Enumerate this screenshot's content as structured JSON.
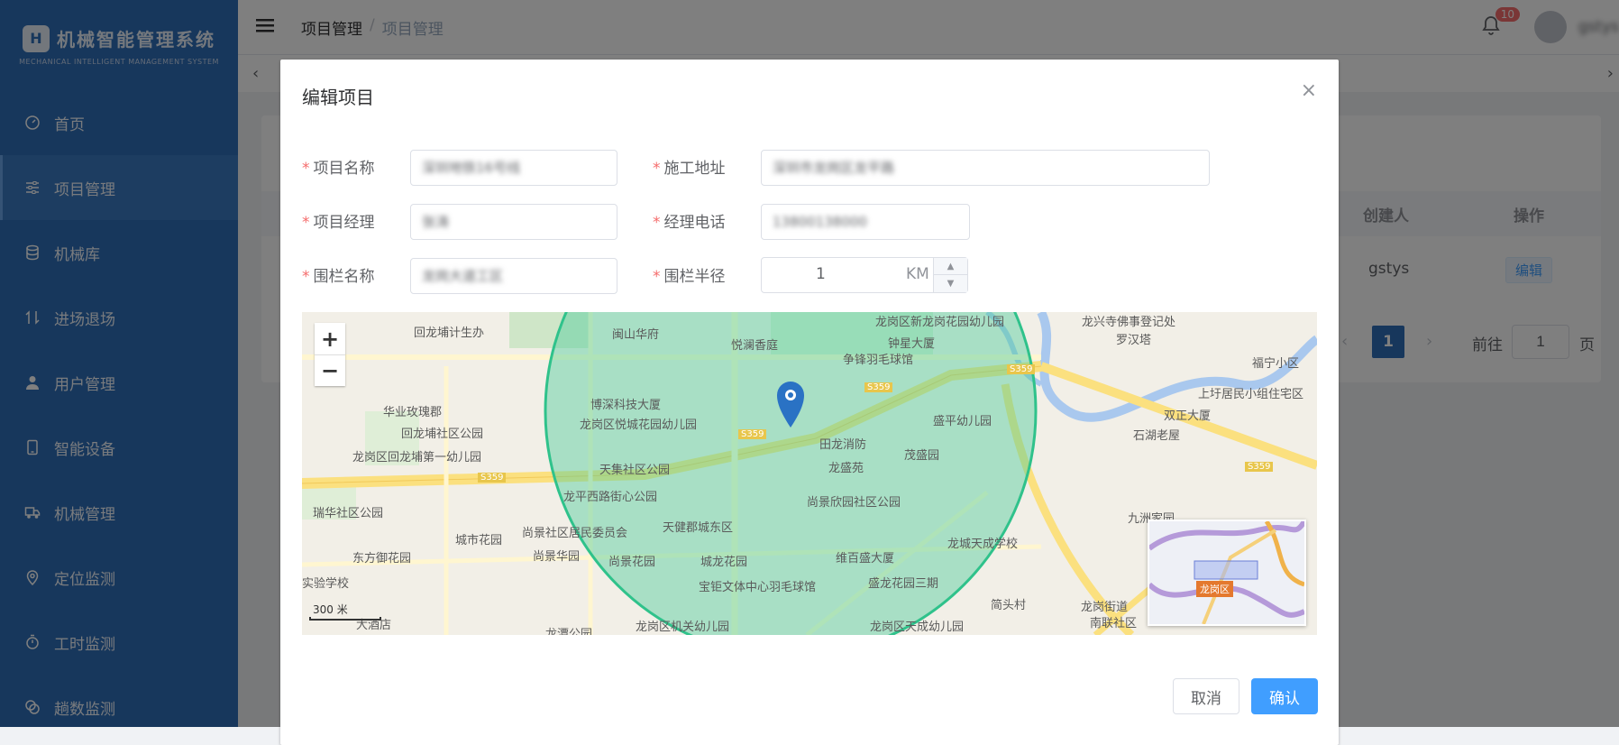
{
  "logo": {
    "title": "机械智能管理系统",
    "subtitle": "MECHANICAL INTELLIGENT MANAGEMENT SYSTEM"
  },
  "sidebar": {
    "items": [
      {
        "label": "首页",
        "icon": "dashboard-icon"
      },
      {
        "label": "项目管理",
        "icon": "sliders-icon",
        "active": true
      },
      {
        "label": "机械库",
        "icon": "database-icon"
      },
      {
        "label": "进场退场",
        "icon": "enter-exit-icon"
      },
      {
        "label": "用户管理",
        "icon": "user-icon"
      },
      {
        "label": "智能设备",
        "icon": "tablet-icon"
      },
      {
        "label": "机械管理",
        "icon": "truck-icon"
      },
      {
        "label": "定位监测",
        "icon": "location-icon"
      },
      {
        "label": "工时监测",
        "icon": "stopwatch-icon"
      },
      {
        "label": "趟数监测",
        "icon": "cycle-icon"
      }
    ]
  },
  "header": {
    "breadcrumb": [
      "项目管理",
      "项目管理"
    ],
    "notification_count": "10",
    "user_name": "gstys"
  },
  "table": {
    "columns": {
      "creator": "创建人",
      "action": "操作"
    },
    "rows": [
      {
        "creator": "gstys",
        "action": "编辑"
      }
    ]
  },
  "pagination": {
    "current": "1",
    "goto_label": "前往",
    "goto_value": "1",
    "page_unit": "页"
  },
  "dialog": {
    "title": "编辑项目",
    "close_symbol": "×",
    "required_mark": "*",
    "fields": {
      "project_name": {
        "label": "项目名称",
        "value": "深圳地铁16号线"
      },
      "address": {
        "label": "施工地址",
        "value": "深圳市龙岗区龙平路"
      },
      "manager": {
        "label": "项目经理",
        "value": "张涛"
      },
      "phone": {
        "label": "经理电话",
        "value": "13800138000"
      },
      "fence_name": {
        "label": "围栏名称",
        "value": "龙岗大道工区"
      },
      "fence_radius": {
        "label": "围栏半径",
        "value": "1",
        "unit": "KM"
      }
    },
    "map": {
      "zoom_in": "+",
      "zoom_out": "−",
      "scale": "300 米",
      "district_badge": "龙岗区",
      "labels": [
        "回龙埔计生办",
        "闽山华府",
        "悦澜香庭",
        "龙岗区新龙岗花园幼儿园",
        "钟星大厦",
        "争锋羽毛球馆",
        "龙兴寺佛事登记处",
        "罗汉塔",
        "福宁小区",
        "上圩居民小组住宅区",
        "双正大厦",
        "石湖老屋",
        "华业玫瑰郡",
        "博深科技大厦",
        "回龙埔社区公园",
        "龙岗区悦城花园幼儿园",
        "盛平幼儿园",
        "田龙消防",
        "龙盛苑",
        "茂盛园",
        "龙岗区回龙埔第一幼儿园",
        "天集社区公园",
        "龙平西路街心公园",
        "尚景欣园社区公园",
        "瑞华社区公园",
        "城市花园",
        "尚景社区居民委员会",
        "天健郡城东区",
        "尚景华园",
        "东方御花园",
        "龙城天成学校",
        "尚景花园",
        "城龙花园",
        "维百盛大厦",
        "盛龙花园三期",
        "九洲家园",
        "实验学校",
        "宝钜文体中心羽毛球馆",
        "简头村",
        "龙岗街道",
        "南联社区",
        "龙岗区机关幼儿园",
        "龙岗区天成幼儿园",
        "龙潭公园",
        "大酒店"
      ],
      "road_labels": [
        "S359",
        "S359",
        "S359",
        "S359",
        "S359",
        "S359"
      ]
    },
    "buttons": {
      "cancel": "取消",
      "confirm": "确认"
    }
  },
  "colors": {
    "sidebar": "#2f6fb8",
    "primary": "#409eff",
    "fence": "#4ecb9c",
    "danger": "#f56c6c"
  }
}
